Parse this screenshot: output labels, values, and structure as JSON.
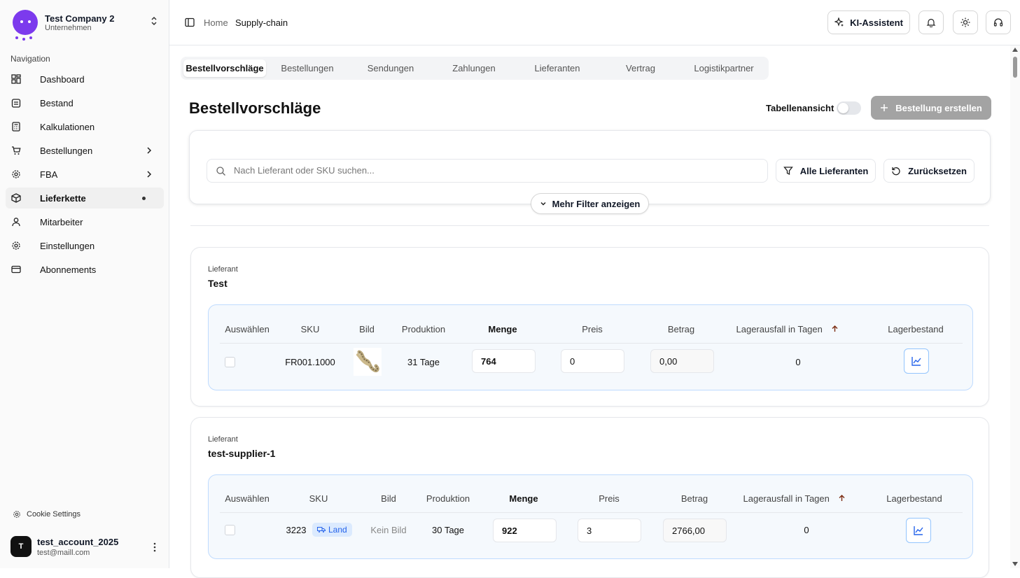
{
  "company": {
    "name": "Test Company 2",
    "subtitle": "Unternehmen"
  },
  "nav": {
    "label": "Navigation",
    "items": [
      {
        "label": "Dashboard",
        "icon": "dashboard-icon"
      },
      {
        "label": "Bestand",
        "icon": "inventory-icon"
      },
      {
        "label": "Kalkulationen",
        "icon": "calculator-icon"
      },
      {
        "label": "Bestellungen",
        "icon": "cart-icon",
        "expandable": true
      },
      {
        "label": "FBA",
        "icon": "gear-icon",
        "expandable": true
      },
      {
        "label": "Lieferkette",
        "icon": "box-icon",
        "active": true
      },
      {
        "label": "Mitarbeiter",
        "icon": "user-icon"
      },
      {
        "label": "Einstellungen",
        "icon": "settings-icon"
      },
      {
        "label": "Abonnements",
        "icon": "card-icon"
      }
    ]
  },
  "cookie_settings": "Cookie Settings",
  "user": {
    "initial": "T",
    "name": "test_account_2025",
    "email": "test@maill.com"
  },
  "breadcrumb": {
    "home": "Home",
    "current": "Supply-chain"
  },
  "header": {
    "ai_button": "KI-Assistent"
  },
  "tabs": [
    "Bestellvorschläge",
    "Bestellungen",
    "Sendungen",
    "Zahlungen",
    "Lieferanten",
    "Vertrag",
    "Logistikpartner"
  ],
  "page": {
    "title": "Bestellvorschläge",
    "table_view_label": "Tabellenansicht",
    "table_view_on": false,
    "create_button": "Bestellung erstellen"
  },
  "filters": {
    "search_placeholder": "Nach Lieferant oder SKU suchen...",
    "supplier_button": "Alle Lieferanten",
    "reset_button": "Zurücksetzen",
    "more_filters": "Mehr Filter anzeigen"
  },
  "columns": [
    "Auswählen",
    "SKU",
    "Bild",
    "Produktion",
    "Menge",
    "Preis",
    "Betrag",
    "Lagerausfall in Tagen",
    "Lagerbestand"
  ],
  "suppliers": [
    {
      "label": "Lieferant",
      "name": "Test",
      "rows": [
        {
          "sku": "FR001.1000",
          "image": "rope-image",
          "production": "31 Tage",
          "quantity": "764",
          "price": "0",
          "amount": "0,00",
          "stockout_days": "0"
        }
      ]
    },
    {
      "label": "Lieferant",
      "name": "test-supplier-1",
      "rows": [
        {
          "sku": "3223",
          "badge": "Land",
          "image_text": "Kein Bild",
          "production": "30 Tage",
          "quantity": "922",
          "price": "3",
          "amount": "2766,00",
          "stockout_days": "0"
        }
      ]
    }
  ],
  "colors": {
    "accent": "#7c3aed",
    "badge_bg": "#dbeafe",
    "badge_text": "#2563eb",
    "table_border": "#bfdbfe",
    "create_button_bg": "#a3a3a3"
  }
}
